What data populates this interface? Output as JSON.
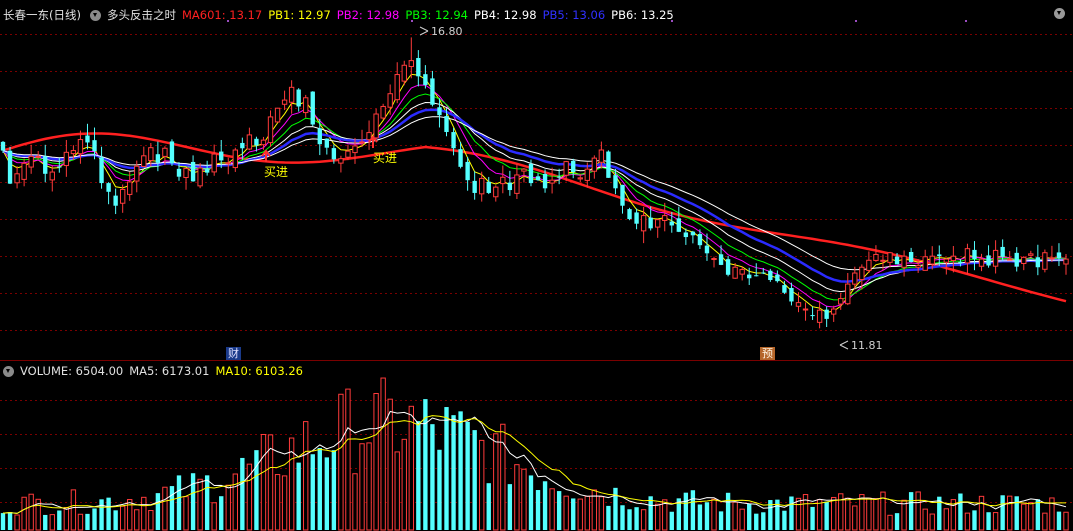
{
  "header": {
    "stock": "长春一东(日线)",
    "indicator": "多头反击之时",
    "ma601": "MA601: 13.17",
    "pb1": "PB1: 12.97",
    "pb2": "PB2: 12.98",
    "pb3": "PB3: 12.94",
    "pb4": "PB4: 12.98",
    "pb5": "PB5: 13.06",
    "pb6": "PB6: 13.25"
  },
  "colors": {
    "up": "#ff3b3b",
    "down": "#54ffff",
    "ma601": "#ff2020",
    "pb1": "#ffff00",
    "pb2": "#ff00ff",
    "pb3": "#00ff00",
    "pb4": "#ffffff",
    "pb5": "#2b2bff",
    "pb6": "#ffffff",
    "grid": "#7a0000",
    "ma5": "#ffffff",
    "ma10": "#ffff00"
  },
  "annotations": {
    "buy_label": "买进",
    "high_label": "16.80",
    "low_label": "11.81",
    "badge_fin": "财",
    "badge_pre": "预"
  },
  "volume_header": {
    "volume": "VOLUME: 6504.00",
    "ma5": "MA5: 6173.01",
    "ma10": "MA10: 6103.26"
  },
  "chart_data": {
    "type": "candlestick",
    "title": "长春一东(日线)",
    "price_high": 16.8,
    "price_low": 11.81,
    "buy_signal_bars": [
      37,
      52
    ],
    "high_bar": 58,
    "low_bar": 117,
    "bar_close": [
      14.85,
      14.28,
      14.45,
      14.63,
      14.75,
      14.75,
      14.45,
      14.48,
      14.57,
      14.82,
      14.85,
      15.04,
      14.99,
      14.84,
      14.29,
      14.14,
      13.9,
      14.18,
      14.31,
      14.58,
      14.76,
      14.9,
      14.64,
      14.89,
      14.63,
      14.4,
      14.54,
      14.32,
      14.55,
      14.47,
      14.79,
      14.68,
      14.64,
      14.86,
      14.89,
      15.12,
      14.94,
      15.03,
      15.43,
      15.58,
      15.72,
      15.94,
      15.61,
      15.76,
      15.3,
      14.96,
      14.9,
      14.7,
      14.71,
      14.84,
      14.93,
      15.0,
      15.16,
      15.48,
      15.61,
      15.83,
      16.16,
      16.32,
      16.4,
      16.13,
      15.98,
      15.64,
      15.46,
      15.17,
      14.89,
      14.57,
      14.34,
      14.12,
      14.37,
      14.12,
      14.22,
      14.39,
      14.17,
      14.43,
      14.53,
      14.29,
      14.34,
      14.2,
      14.34,
      14.39,
      14.66,
      14.48,
      14.38,
      14.53,
      14.72,
      14.86,
      14.38,
      14.2,
      13.9,
      13.67,
      13.59,
      13.73,
      13.51,
      13.66,
      13.73,
      13.56,
      13.45,
      13.36,
      13.39,
      13.22,
      13.08,
      12.99,
      12.88,
      12.71,
      12.84,
      12.8,
      12.65,
      12.7,
      12.74,
      12.62,
      12.6,
      12.4,
      12.25,
      12.23,
      12.12,
      12.01,
      12.1,
      11.95,
      12.12,
      12.3,
      12.55,
      12.74,
      12.84,
      12.96,
      13.06,
      12.96,
      13.09,
      12.89,
      13.03,
      12.93,
      12.87,
      13.02,
      13.03,
      13.03,
      12.98,
      13.03,
      12.92,
      13.16,
      12.98,
      12.98,
      12.87,
      13.13,
      13.02,
      12.98,
      12.85,
      13.01,
      13.07,
      12.84,
      13.09,
      13.0,
      13.0,
      12.98
    ]
  }
}
